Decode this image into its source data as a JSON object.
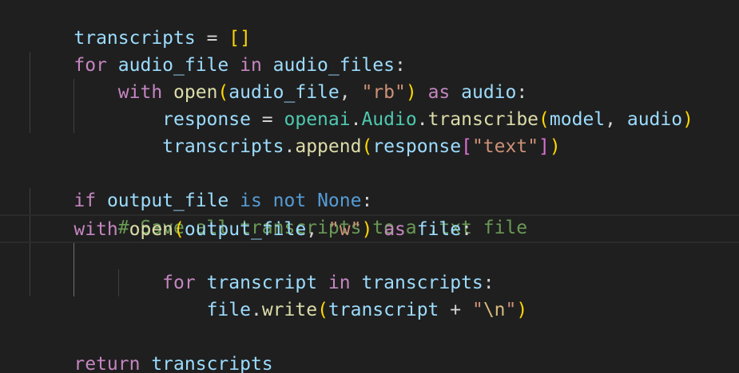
{
  "editor": {
    "lines": [
      "transcripts = []",
      "for audio_file in audio_files:",
      "    with open(audio_file, \"rb\") as audio:",
      "        response = openai.Audio.transcribe(model, audio)",
      "        transcripts.append(response[\"text\"])",
      "",
      "if output_file is not None:",
      "    # Save all transcripts to a .txt file",
      "    with open(output_file, \"w\") as file:",
      "        for transcript in transcripts:",
      "            file.write(transcript + \"\\n\")",
      "",
      "return transcripts"
    ]
  },
  "colors": {
    "background": "#1f1f1f",
    "variable": "#9cdcfe",
    "control_keyword": "#c586c0",
    "keyword": "#569cd6",
    "function": "#dcdcaa",
    "class": "#4ec9b0",
    "string": "#ce9178",
    "comment": "#6a9955",
    "escape": "#d7ba7d",
    "operator": "#d4d4d4",
    "bracket_level_1": "#ffd700",
    "bracket_level_2": "#da70d6"
  }
}
